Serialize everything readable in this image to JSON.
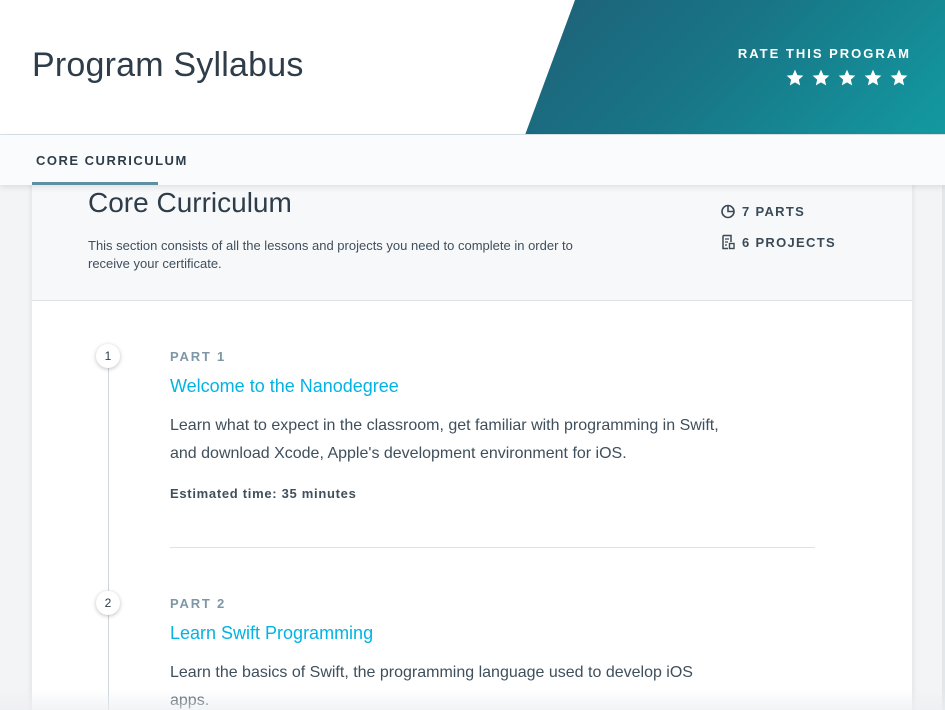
{
  "header": {
    "title": "Program Syllabus",
    "rate_label": "RATE THIS PROGRAM",
    "stars": 5,
    "gradient_colors": [
      "#1f6078",
      "#139aa1"
    ]
  },
  "tabs": [
    {
      "label": "CORE CURRICULUM",
      "active": true
    }
  ],
  "section": {
    "title": "Core Curriculum",
    "description": "This section consists of all the lessons and projects you need to complete in order to receive your certificate.",
    "parts_count": "7 PARTS",
    "projects_count": "6 PROJECTS"
  },
  "parts": [
    {
      "number": "1",
      "label": "PART 1",
      "title": "Welcome to the Nanodegree",
      "description": "Learn what to expect in the classroom, get familiar with programming in Swift, and download Xcode, Apple's development environment for iOS.",
      "estimate": "Estimated time: 35 minutes"
    },
    {
      "number": "2",
      "label": "PART 2",
      "title": "Learn Swift Programming",
      "description": "Learn the basics of Swift, the programming language used to develop iOS apps."
    }
  ],
  "colors": {
    "link": "#02b3e4",
    "tab_underline": "#5f8fa1",
    "text": "#2e3d49"
  },
  "icons": {
    "rating": "star-icon",
    "parts": "pie-chart-icon",
    "projects": "project-document-icon"
  }
}
